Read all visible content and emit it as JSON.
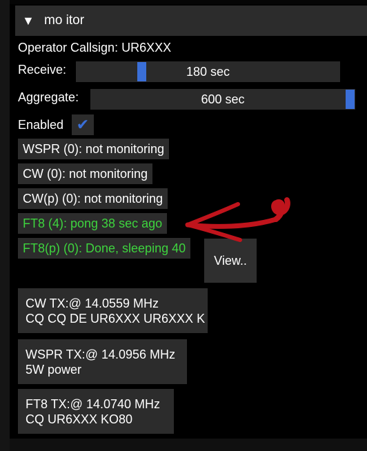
{
  "header": {
    "collapse_glyph": "▼",
    "title": "mo itor"
  },
  "operator": {
    "label": "Operator Callsign: UR6XXX"
  },
  "receive": {
    "label": "Receive:",
    "value": "180 sec",
    "fraction": 0.24
  },
  "aggregate": {
    "label": "Aggregate:",
    "value": "600 sec",
    "fraction": 1.0
  },
  "enabled": {
    "label": "Enabled",
    "checked": true,
    "check_glyph": "✔"
  },
  "statuses": [
    {
      "text": "WSPR (0): not monitoring",
      "color": "#ffffff"
    },
    {
      "text": "CW (0): not monitoring",
      "color": "#ffffff"
    },
    {
      "text": "CW(p) (0): not monitoring",
      "color": "#ffffff"
    },
    {
      "text": "FT8 (4): pong 38 sec ago",
      "color": "#3ed33e"
    },
    {
      "text": "FT8(p) (0): Done, sleeping 40",
      "color": "#3ed33e"
    }
  ],
  "view_button": {
    "label": "View.."
  },
  "tx_blocks": [
    {
      "line1": "CW TX:@ 14.0559 MHz",
      "line2": "CQ CQ DE UR6XXX UR6XXX K"
    },
    {
      "line1": "WSPR TX:@ 14.0956 MHz",
      "line2": "5W power"
    },
    {
      "line1": "FT8 TX:@ 14.0740 MHz",
      "line2": "CQ UR6XXX KO80"
    }
  ],
  "colors": {
    "accent": "#3a6fd8",
    "status_green": "#3ed33e",
    "annotation": "#c0141c"
  },
  "icons": {
    "collapse": "triangle-down-icon",
    "check": "checkmark-icon",
    "annotation": "red-arrow-annotation"
  }
}
